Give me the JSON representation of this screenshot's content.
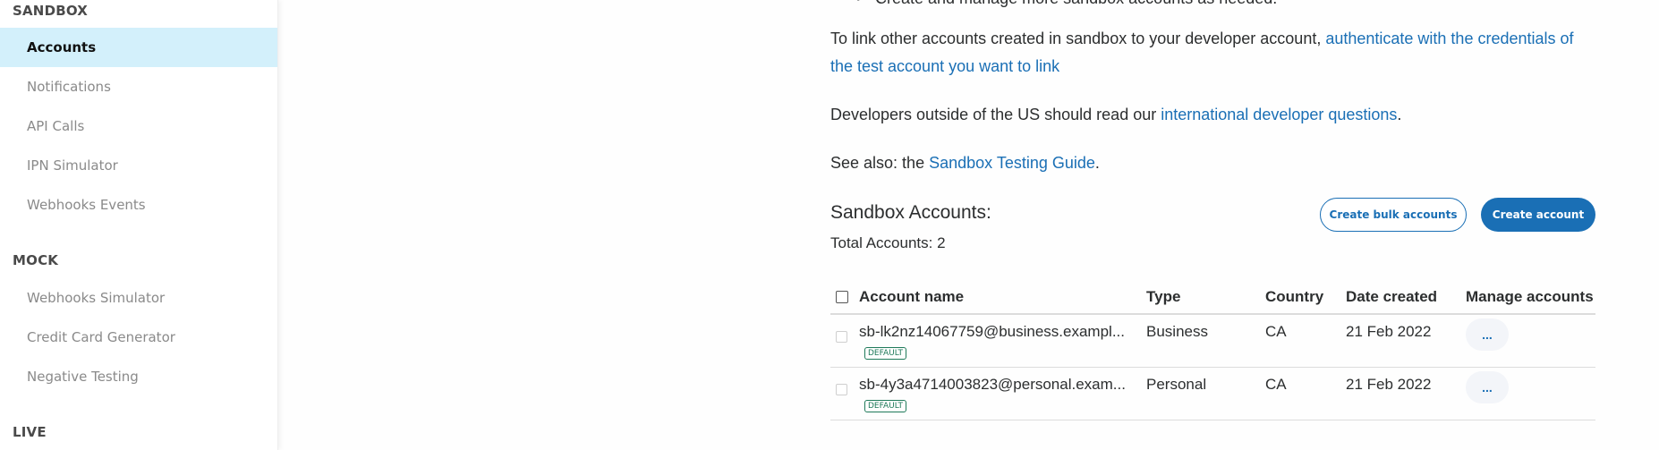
{
  "sidebar": {
    "sections": [
      {
        "title": "SANDBOX",
        "items": [
          {
            "label": "Accounts",
            "active": true
          },
          {
            "label": "Notifications"
          },
          {
            "label": "API Calls"
          },
          {
            "label": "IPN Simulator"
          },
          {
            "label": "Webhooks Events"
          }
        ]
      },
      {
        "title": "MOCK",
        "items": [
          {
            "label": "Webhooks Simulator"
          },
          {
            "label": "Credit Card Generator"
          },
          {
            "label": "Negative Testing"
          }
        ]
      },
      {
        "title": "LIVE",
        "items": []
      }
    ]
  },
  "main": {
    "bullet_text": "Create and manage more sandbox accounts as needed.",
    "link_paragraph": {
      "text": "To link other accounts created in sandbox to your developer account, ",
      "link": "authenticate with the credentials of the test account you want to link"
    },
    "intl_paragraph": {
      "text": "Developers outside of the US should read our ",
      "link": "international developer questions",
      "suffix": "."
    },
    "see_also": {
      "text": "See also: the ",
      "link": "Sandbox Testing Guide",
      "suffix": "."
    },
    "accounts_title": "Sandbox Accounts:",
    "total_accounts": "Total Accounts: 2",
    "buttons": {
      "create_bulk": "Create bulk accounts",
      "create": "Create account"
    },
    "table": {
      "headers": [
        "Account name",
        "Type",
        "Country",
        "Date created",
        "Manage accounts"
      ],
      "rows": [
        {
          "account": "sb-lk2nz14067759@business.exampl...",
          "badge": "DEFAULT",
          "type": "Business",
          "country": "CA",
          "date": "21 Feb 2022",
          "manage": "..."
        },
        {
          "account": "sb-4y3a4714003823@personal.exam...",
          "badge": "DEFAULT",
          "type": "Personal",
          "country": "CA",
          "date": "21 Feb 2022",
          "manage": "..."
        }
      ]
    }
  },
  "colors": {
    "accent": "#1a6fb5",
    "active_nav_bg": "#d3f0fb",
    "badge": "#1f7a5a"
  }
}
